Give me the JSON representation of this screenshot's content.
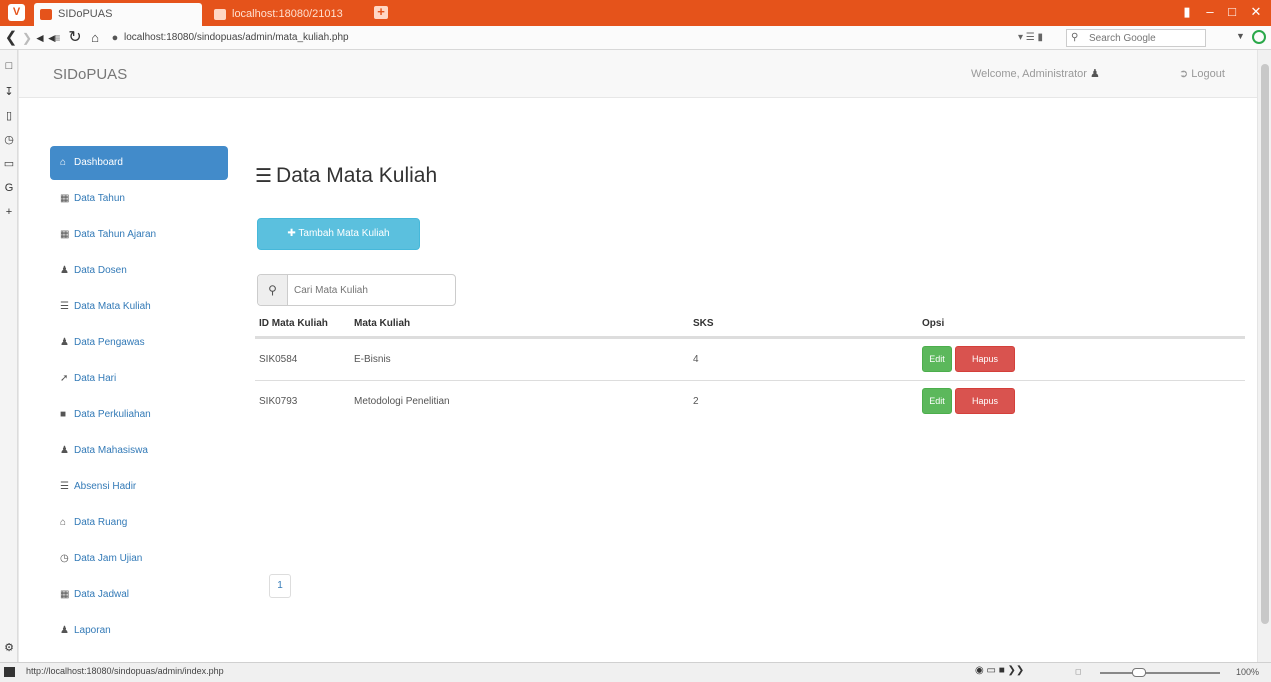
{
  "browser": {
    "tabs": [
      {
        "label": "SIDoPUAS"
      },
      {
        "label": "localhost:18080/21013"
      }
    ],
    "new_tab": "+",
    "url": "localhost:18080/sindopuas/admin/mata_kuliah.php",
    "search_placeholder": "Search Google",
    "status_url": "http://localhost:18080/sindopuas/admin/index.php",
    "zoom": "100%"
  },
  "navbar": {
    "brand": "SIDoPUAS",
    "welcome": "Welcome, Administrator",
    "logout": "Logout"
  },
  "sidebar": {
    "items": [
      {
        "label": "Dashboard",
        "active": true
      },
      {
        "label": "Data Tahun"
      },
      {
        "label": "Data Tahun Ajaran"
      },
      {
        "label": "Data Dosen"
      },
      {
        "label": "Data Mata Kuliah"
      },
      {
        "label": "Data Pengawas"
      },
      {
        "label": "Data Hari"
      },
      {
        "label": "Data Perkuliahan"
      },
      {
        "label": "Data Mahasiswa"
      },
      {
        "label": "Absensi Hadir"
      },
      {
        "label": "Data Ruang"
      },
      {
        "label": "Data Jam Ujian"
      },
      {
        "label": "Data Jadwal"
      },
      {
        "label": "Laporan"
      }
    ]
  },
  "main": {
    "title": "Data Mata Kuliah",
    "add_button": "Tambah Mata Kuliah",
    "search_placeholder": "Cari Mata Kuliah",
    "table": {
      "headers": [
        "ID Mata Kuliah",
        "Mata Kuliah",
        "SKS",
        "Opsi"
      ],
      "rows": [
        {
          "id": "SIK0584",
          "name": "E-Bisnis",
          "sks": "4"
        },
        {
          "id": "SIK0793",
          "name": "Metodologi Penelitian",
          "sks": "2"
        }
      ],
      "edit_label": "Edit",
      "delete_label": "Hapus"
    },
    "pagination": [
      "1"
    ]
  },
  "colors": {
    "browser_accent": "#e5531b",
    "primary": "#428bca",
    "info": "#5bc0de",
    "success": "#5cb85c",
    "danger": "#d9534f"
  }
}
